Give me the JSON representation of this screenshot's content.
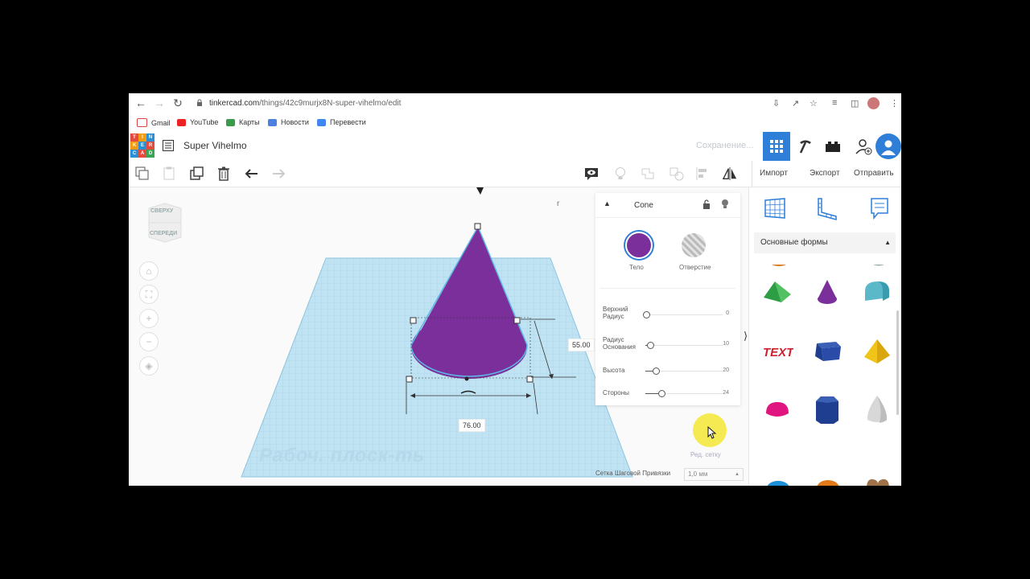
{
  "browser": {
    "url_host": "tinkercad.com",
    "url_path": "/things/42c9murjx8N-super-vihelmo/edit",
    "bookmarks": [
      "Gmail",
      "YouTube",
      "Карты",
      "Новости",
      "Перевести"
    ]
  },
  "header": {
    "logo_letters": [
      "T",
      "I",
      "N",
      "K",
      "E",
      "R",
      "C",
      "A",
      "D"
    ],
    "design_title": "Super Vihelmo",
    "save_status": "Сохранение..."
  },
  "toolbar": {
    "import_label": "Импорт",
    "export_label": "Экспорт",
    "send_label": "Отправить"
  },
  "viewcube": {
    "top_label": "СВЕРХУ",
    "front_label": "СПЕРЕДИ"
  },
  "workplane": {
    "label": "Рабоч. плоск-ть",
    "dim_width": "76.00",
    "dim_height": "55.00"
  },
  "inspector": {
    "shape_name": "Cone",
    "solid_label": "Тело",
    "hole_label": "Отверстие",
    "solid_color": "#7b2f9b",
    "props": [
      {
        "label_line1": "Верхний",
        "label_line2": "Радиус",
        "value": "0",
        "level": 0.0
      },
      {
        "label_line1": "Радиус",
        "label_line2": "Основания",
        "value": "10",
        "level": 0.05
      },
      {
        "label_line1": "Высота",
        "label_line2": "",
        "value": "20",
        "level": 0.12
      },
      {
        "label_line1": "Стороны",
        "label_line2": "",
        "value": "24",
        "level": 0.2
      }
    ],
    "edit_grid_label": "Ред. сетку",
    "snap_label": "Сетка Шаговой Привязки",
    "snap_value": "1,0 мм"
  },
  "shapes_panel": {
    "category": "Основные формы",
    "shapes": [
      "roof-icon",
      "cone-icon",
      "round-roof-icon",
      "text-icon",
      "box-icon",
      "pyramid-icon",
      "half-sphere-icon",
      "polygon-icon",
      "paraboloid-icon"
    ],
    "text_shape_label": "TEXT"
  },
  "colors": {
    "accent": "#2f7fd8",
    "cone": "#7b2f9b",
    "workplane": "#bfe3f3",
    "cursor": "#f5e94a"
  }
}
